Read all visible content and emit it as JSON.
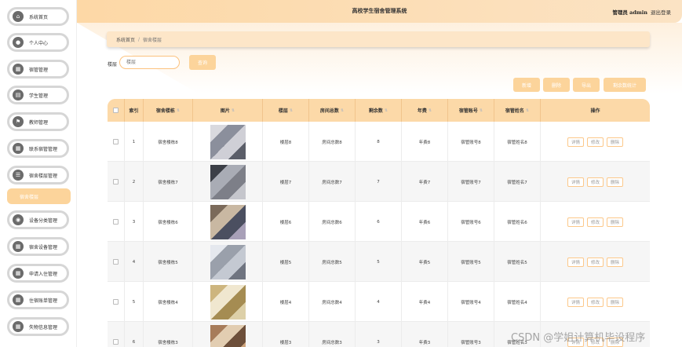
{
  "sidebar": {
    "items": [
      {
        "label": "系统首页",
        "icon": "home-icon",
        "glyph": "⌂"
      },
      {
        "label": "个人中心",
        "icon": "user-icon",
        "glyph": "●"
      },
      {
        "label": "宿管管理",
        "icon": "grid-icon",
        "glyph": "▦"
      },
      {
        "label": "学生管理",
        "icon": "notebook-icon",
        "glyph": "▤"
      },
      {
        "label": "教师管理",
        "icon": "flag-icon",
        "glyph": "⚑"
      },
      {
        "label": "联系宿管管理",
        "icon": "grid-icon",
        "glyph": "▦"
      },
      {
        "label": "宿舍楼层管理",
        "icon": "list-icon",
        "glyph": "☰"
      },
      {
        "label": "设备分类管理",
        "icon": "location-icon",
        "glyph": "◉"
      },
      {
        "label": "宿舍设备管理",
        "icon": "grid-icon",
        "glyph": "▦"
      },
      {
        "label": "申请入住管理",
        "icon": "grid-icon",
        "glyph": "▦"
      },
      {
        "label": "住宿账单管理",
        "icon": "grid-icon",
        "glyph": "▦"
      },
      {
        "label": "失物信息管理",
        "icon": "grid-icon",
        "glyph": "▦"
      }
    ],
    "active_sub": "宿舍楼层"
  },
  "header": {
    "title": "高校学生宿舍管理系统",
    "user": "管理员 admin",
    "logout": "退出登录"
  },
  "breadcrumb": {
    "home": "系统首页",
    "separator": "/",
    "current": "宿舍楼层"
  },
  "search": {
    "label": "楼层",
    "placeholder": "楼层",
    "button": "查询"
  },
  "actions": {
    "add": "新增",
    "delete": "删除",
    "export": "导出",
    "stats": "剩余数统计"
  },
  "table": {
    "headers": {
      "index": "索引",
      "building": "宿舍楼栋",
      "image": "图片",
      "floor": "楼层",
      "rooms": "房间总数",
      "remaining": "剩余数",
      "year": "年费",
      "account": "宿管账号",
      "name": "宿管姓名",
      "ops": "操作"
    },
    "op_labels": {
      "detail": "详情",
      "edit": "修改",
      "delete": "删除"
    },
    "rows": [
      {
        "index": "1",
        "building": "宿舍楼栋8",
        "floor": "楼层8",
        "rooms": "房间总数8",
        "remaining": "8",
        "year": "年费8",
        "account": "宿管账号8",
        "name": "宿管姓名8"
      },
      {
        "index": "2",
        "building": "宿舍楼栋7",
        "floor": "楼层7",
        "rooms": "房间总数7",
        "remaining": "7",
        "year": "年费7",
        "account": "宿管账号7",
        "name": "宿管姓名7"
      },
      {
        "index": "3",
        "building": "宿舍楼栋6",
        "floor": "楼层6",
        "rooms": "房间总数6",
        "remaining": "6",
        "year": "年费6",
        "account": "宿管账号6",
        "name": "宿管姓名6"
      },
      {
        "index": "4",
        "building": "宿舍楼栋5",
        "floor": "楼层5",
        "rooms": "房间总数5",
        "remaining": "5",
        "year": "年费5",
        "account": "宿管账号5",
        "name": "宿管姓名5"
      },
      {
        "index": "5",
        "building": "宿舍楼栋4",
        "floor": "楼层4",
        "rooms": "房间总数4",
        "remaining": "4",
        "year": "年费4",
        "account": "宿管账号4",
        "name": "宿管姓名4"
      },
      {
        "index": "6",
        "building": "宿舍楼栋3",
        "floor": "楼层3",
        "rooms": "房间总数3",
        "remaining": "3",
        "year": "年费3",
        "account": "宿管账号3",
        "name": "宿管姓名3"
      }
    ]
  },
  "watermark": "CSDN @学姐计算机毕设程序",
  "colors": {
    "accent": "#fcd49b",
    "header_bg": "#fdd8a6",
    "table_head": "#fcd9a8"
  }
}
